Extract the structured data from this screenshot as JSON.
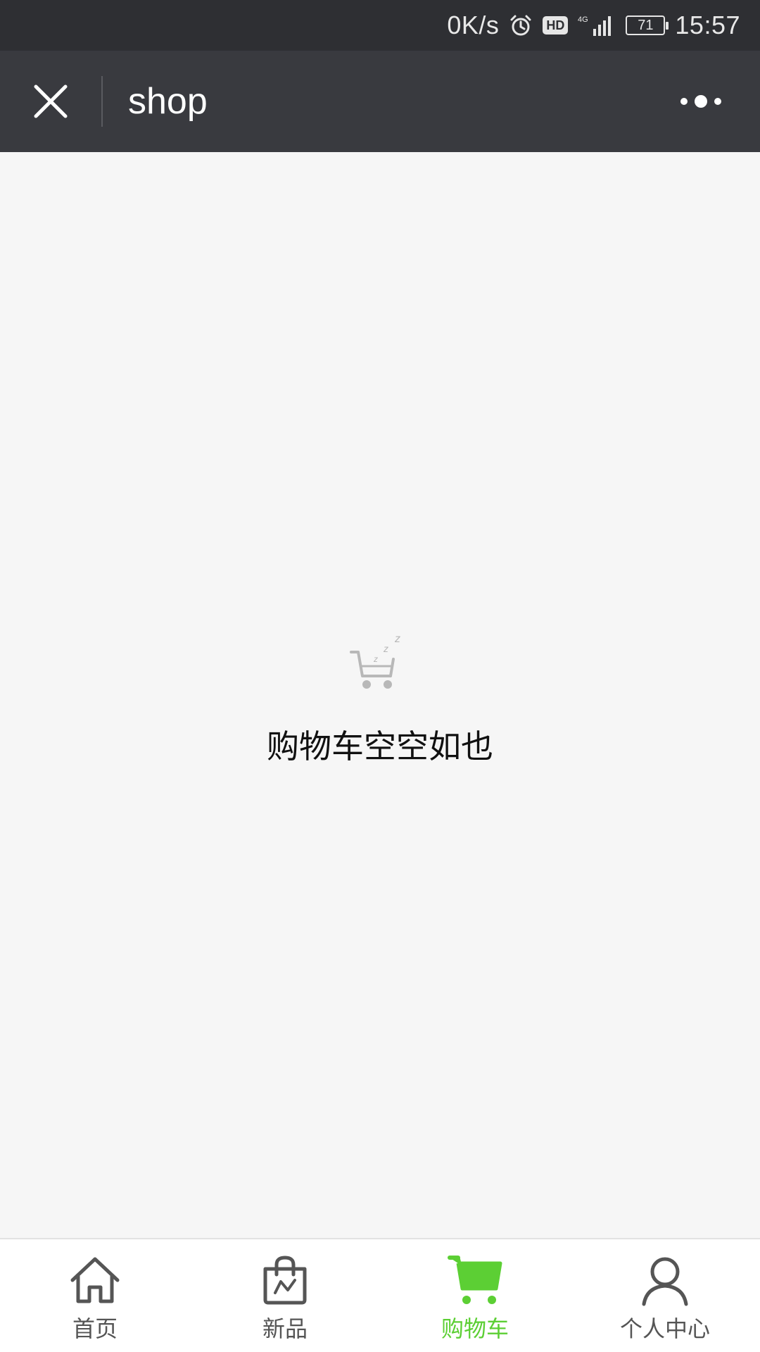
{
  "status_bar": {
    "net_speed": "0K/s",
    "hd": "HD",
    "network": "4G",
    "battery": "71",
    "time": "15:57"
  },
  "header": {
    "title": "shop"
  },
  "empty_state": {
    "message": "购物车空空如也"
  },
  "tabbar": {
    "accent_color": "#5ccf34",
    "tabs": [
      {
        "label": "首页",
        "icon": "home-icon"
      },
      {
        "label": "新品",
        "icon": "shopping-bag-icon"
      },
      {
        "label": "购物车",
        "icon": "cart-icon",
        "active": true
      },
      {
        "label": "个人中心",
        "icon": "person-icon"
      }
    ]
  }
}
